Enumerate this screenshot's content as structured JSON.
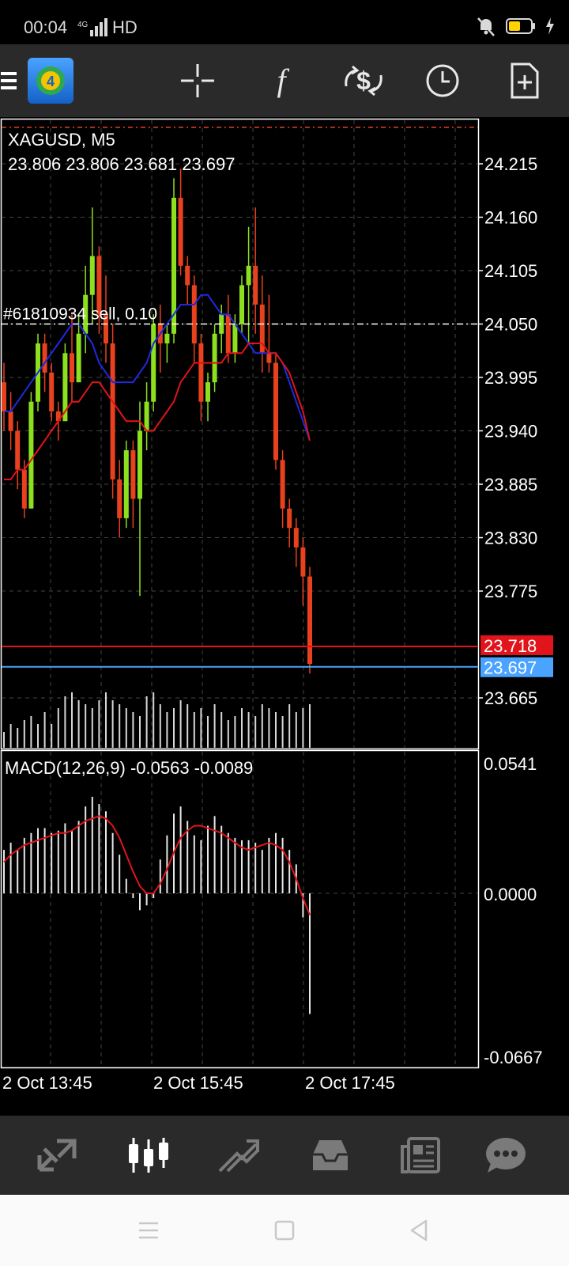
{
  "status_bar": {
    "time": "00:04",
    "network": "HD",
    "battery_color": "#ffd400"
  },
  "toolbar": {
    "icons": [
      "menu-icon",
      "mt4-logo-icon",
      "crosshair-icon",
      "function-icon",
      "currency-exchange-icon",
      "clock-icon",
      "new-document-icon"
    ],
    "logo_text": "4"
  },
  "chart": {
    "symbol_timeframe": "XAGUSD, M5",
    "ohlc": "23.806 23.806 23.681 23.697",
    "order_line_label": "#61810934 sell, 0.10",
    "order_price": 24.05,
    "ask_price_label": "23.718",
    "bid_price_label": "23.697",
    "ask_color": "#e0141a",
    "bid_color": "#4aa3ff",
    "bull_color": "#8ce01e",
    "bear_color": "#e8411e",
    "price_axis": [
      "24.215",
      "24.160",
      "24.105",
      "24.050",
      "23.995",
      "23.940",
      "23.885",
      "23.830",
      "23.775",
      "23.665"
    ],
    "time_axis": [
      "2 Oct 13:45",
      "2 Oct 15:45",
      "2 Oct 17:45"
    ]
  },
  "macd": {
    "label": "MACD(12,26,9) -0.0563 -0.0089",
    "axis": [
      "0.0541",
      "0.0000",
      "-0.0667"
    ],
    "signal_color": "#e0141a"
  },
  "chart_data": {
    "type": "candlestick",
    "ylim": [
      23.64,
      24.24
    ],
    "ma_fast_color": "#1e2adf",
    "ma_slow_color": "#e0141a",
    "candles": [
      [
        23.99,
        24.01,
        23.94,
        23.96
      ],
      [
        23.96,
        23.98,
        23.92,
        23.94
      ],
      [
        23.94,
        23.95,
        23.88,
        23.9
      ],
      [
        23.9,
        23.91,
        23.85,
        23.86
      ],
      [
        23.86,
        23.98,
        23.86,
        23.97
      ],
      [
        23.97,
        24.04,
        23.96,
        24.03
      ],
      [
        24.03,
        24.04,
        23.98,
        24.0
      ],
      [
        24.0,
        24.01,
        23.95,
        23.96
      ],
      [
        23.96,
        23.97,
        23.93,
        23.95
      ],
      [
        23.95,
        24.03,
        23.95,
        24.02
      ],
      [
        24.02,
        24.06,
        23.97,
        23.99
      ],
      [
        23.99,
        24.06,
        23.99,
        24.04
      ],
      [
        24.04,
        24.11,
        24.02,
        24.08
      ],
      [
        24.08,
        24.17,
        24.05,
        24.12
      ],
      [
        24.12,
        24.13,
        24.04,
        24.06
      ],
      [
        24.06,
        24.1,
        24.01,
        24.03
      ],
      [
        24.03,
        24.05,
        23.87,
        23.89
      ],
      [
        23.89,
        23.91,
        23.83,
        23.85
      ],
      [
        23.85,
        23.93,
        23.84,
        23.92
      ],
      [
        23.92,
        23.93,
        23.84,
        23.87
      ],
      [
        23.87,
        23.97,
        23.77,
        23.94
      ],
      [
        23.94,
        23.99,
        23.92,
        23.97
      ],
      [
        23.97,
        24.06,
        23.96,
        24.05
      ],
      [
        24.05,
        24.07,
        24.0,
        24.03
      ],
      [
        24.03,
        24.05,
        24.01,
        24.04
      ],
      [
        24.04,
        24.2,
        24.03,
        24.18
      ],
      [
        24.18,
        24.21,
        24.1,
        24.11
      ],
      [
        24.11,
        24.12,
        24.07,
        24.09
      ],
      [
        24.09,
        24.1,
        24.01,
        24.03
      ],
      [
        24.03,
        24.04,
        23.95,
        23.97
      ],
      [
        23.97,
        24.0,
        23.95,
        23.99
      ],
      [
        23.99,
        24.05,
        23.98,
        24.04
      ],
      [
        24.04,
        24.07,
        24.02,
        24.06
      ],
      [
        24.06,
        24.08,
        24.01,
        24.02
      ],
      [
        24.02,
        24.06,
        24.01,
        24.05
      ],
      [
        24.05,
        24.1,
        24.04,
        24.09
      ],
      [
        24.09,
        24.15,
        24.03,
        24.11
      ],
      [
        24.11,
        24.17,
        24.04,
        24.07
      ],
      [
        24.07,
        24.1,
        24.0,
        24.02
      ],
      [
        24.02,
        24.08,
        24.0,
        24.01
      ],
      [
        24.01,
        24.02,
        23.9,
        23.91
      ],
      [
        23.91,
        23.92,
        23.84,
        23.86
      ],
      [
        23.86,
        23.87,
        23.82,
        23.84
      ],
      [
        23.84,
        23.85,
        23.8,
        23.82
      ],
      [
        23.82,
        23.83,
        23.76,
        23.79
      ],
      [
        23.79,
        23.8,
        23.69,
        23.7
      ]
    ],
    "ma_fast": [
      23.96,
      23.96,
      23.97,
      23.98,
      23.99,
      24.0,
      24.01,
      24.02,
      24.03,
      24.04,
      24.05,
      24.05,
      24.04,
      24.03,
      24.01,
      24.0,
      23.99,
      23.99,
      23.99,
      23.99,
      24.0,
      24.01,
      24.03,
      24.04,
      24.05,
      24.06,
      24.07,
      24.07,
      24.07,
      24.08,
      24.08,
      24.07,
      24.06,
      24.06,
      24.05,
      24.04,
      24.03,
      24.02,
      24.02,
      24.02,
      24.02,
      24.01,
      23.99,
      23.97,
      23.95,
      23.93
    ],
    "ma_slow": [
      23.89,
      23.89,
      23.9,
      23.9,
      23.91,
      23.92,
      23.93,
      23.94,
      23.95,
      23.96,
      23.97,
      23.97,
      23.98,
      23.99,
      23.99,
      23.98,
      23.97,
      23.96,
      23.95,
      23.95,
      23.95,
      23.94,
      23.94,
      23.95,
      23.96,
      23.97,
      23.99,
      24.0,
      24.01,
      24.01,
      24.01,
      24.01,
      24.01,
      24.02,
      24.02,
      24.02,
      24.03,
      24.03,
      24.03,
      24.02,
      24.02,
      24.01,
      24.0,
      23.98,
      23.96,
      23.93
    ],
    "volume": [
      0.2,
      0.3,
      0.25,
      0.35,
      0.4,
      0.3,
      0.45,
      0.3,
      0.5,
      0.65,
      0.7,
      0.6,
      0.55,
      0.5,
      0.6,
      0.7,
      0.6,
      0.55,
      0.5,
      0.45,
      0.4,
      0.65,
      0.7,
      0.55,
      0.45,
      0.5,
      0.6,
      0.55,
      0.45,
      0.5,
      0.4,
      0.55,
      0.45,
      0.35,
      0.4,
      0.5,
      0.45,
      0.4,
      0.55,
      0.5,
      0.45,
      0.4,
      0.55,
      0.45,
      0.5,
      0.55
    ],
    "macd_ylim": [
      -0.0667,
      0.0541
    ],
    "macd_hist": [
      0.018,
      0.021,
      0.018,
      0.023,
      0.025,
      0.027,
      0.027,
      0.025,
      0.026,
      0.029,
      0.026,
      0.03,
      0.036,
      0.04,
      0.037,
      0.034,
      0.025,
      0.016,
      0.006,
      -0.002,
      -0.007,
      -0.005,
      -0.002,
      0.014,
      0.024,
      0.033,
      0.036,
      0.03,
      0.024,
      0.022,
      0.028,
      0.032,
      0.028,
      0.025,
      0.023,
      0.022,
      0.022,
      0.021,
      0.018,
      0.023,
      0.025,
      0.023,
      0.018,
      0.012,
      -0.01,
      -0.05
    ],
    "macd_signal": [
      0.013,
      0.016,
      0.018,
      0.02,
      0.021,
      0.022,
      0.023,
      0.024,
      0.025,
      0.025,
      0.026,
      0.028,
      0.03,
      0.031,
      0.032,
      0.031,
      0.028,
      0.023,
      0.016,
      0.009,
      0.003,
      0.0,
      0.0,
      0.004,
      0.01,
      0.017,
      0.023,
      0.026,
      0.028,
      0.028,
      0.027,
      0.026,
      0.025,
      0.023,
      0.021,
      0.019,
      0.018,
      0.019,
      0.02,
      0.021,
      0.02,
      0.018,
      0.013,
      0.006,
      -0.002,
      -0.009
    ]
  },
  "bottom_nav": {
    "items": [
      "quotes-icon",
      "chart-icon",
      "trade-icon",
      "history-icon",
      "news-icon",
      "chat-icon"
    ],
    "active_index": 1
  },
  "system_nav": {
    "items": [
      "recents-icon",
      "home-icon",
      "back-icon"
    ]
  }
}
